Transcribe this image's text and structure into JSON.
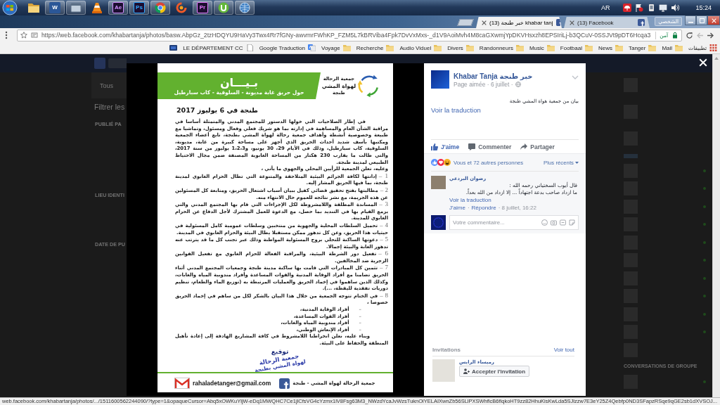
{
  "taskbar": {
    "items": [
      {
        "kind": "globe",
        "open": true
      },
      {
        "kind": "disc",
        "open": true
      },
      {
        "kind": "app-tile",
        "label": "Pr",
        "color": "#e77cff",
        "open": true
      },
      {
        "kind": "swirl",
        "open": false
      },
      {
        "kind": "ring",
        "open": true
      },
      {
        "kind": "app-tile",
        "label": "Ps",
        "color": "#31a8ff",
        "open": true
      },
      {
        "kind": "app-tile",
        "label": "Ae",
        "color": "#d291ff",
        "open": true
      },
      {
        "kind": "cone",
        "open": false
      },
      {
        "kind": "window",
        "open": true
      },
      {
        "kind": "doc-tile",
        "label": "W",
        "color": "#2b5797",
        "open": true
      },
      {
        "kind": "folder",
        "open": false
      }
    ],
    "language": "AR",
    "clock": "15:24"
  },
  "browser": {
    "tabs": [
      {
        "title": "(13) Facebook",
        "selected": false
      },
      {
        "title": "(13) خبر طنجة khabar tanj",
        "selected": true
      }
    ],
    "profile": "الشخصي",
    "navigation": {
      "back_disabled": false,
      "forward_disabled": true
    },
    "url": "https://web.facebook.com/khabartanja/photos/basw.AbpGz_2tzHDQYU9HaVy3Twx4Rr7fGNy-awvmrFWhKP_FZM5L7kBRViba4Fpk7DvVxMxs-_d1V9AoiMvh4M8caGXwmjYpDKVHsxzh8EPSIriLj-b3QCuV-0SSJVt9pDT6Hcqa3",
    "security": "آمن",
    "bookmarks": [
      {
        "kind": "apps",
        "label": "تطبيقات"
      },
      {
        "kind": "folder",
        "label": "Mail"
      },
      {
        "kind": "folder",
        "label": "Tanger"
      },
      {
        "kind": "folder",
        "label": "News"
      },
      {
        "kind": "folder",
        "label": "Footbaal"
      },
      {
        "kind": "folder",
        "label": "Music"
      },
      {
        "kind": "folder",
        "label": "Randonneurs"
      },
      {
        "kind": "folder",
        "label": "Divers"
      },
      {
        "kind": "folder",
        "label": "Audio Viduel"
      },
      {
        "kind": "folder",
        "label": "Recherche"
      },
      {
        "kind": "folder",
        "label": "Voyage"
      },
      {
        "kind": "translate",
        "label": "Google Traduction"
      },
      {
        "kind": "page",
        "label": "LE DÉPARTEMENT CC"
      },
      {
        "kind": "site"
      }
    ]
  },
  "facebook_page": {
    "tab": "Tous",
    "filters": {
      "title": "Filtrer les",
      "sections": [
        "PUBLIÉ PA",
        "LIEU IDENTI",
        "DATE DE PU"
      ]
    },
    "sidebar": [
      {
        "kind": "notice"
      },
      {
        "kind": "notice"
      },
      {
        "kind": "notice"
      },
      {
        "kind": "banner"
      },
      {
        "kind": "contact",
        "online": true
      },
      {
        "kind": "contact",
        "online": true
      },
      {
        "kind": "contact",
        "online": true
      },
      {
        "kind": "contact",
        "online": true
      },
      {
        "kind": "contact",
        "online": true
      },
      {
        "kind": "contact",
        "online": true
      },
      {
        "kind": "contact",
        "online": true
      },
      {
        "kind": "contact",
        "online": true
      },
      {
        "kind": "contact",
        "online": true
      },
      {
        "kind": "contact",
        "online": true
      },
      {
        "kind": "contact",
        "online": false
      },
      {
        "kind": "heading",
        "text": "CONVERSATIONS DE GROUPE"
      },
      {
        "kind": "contact",
        "online": true
      }
    ]
  },
  "photo_viewer": {
    "document": {
      "title": "بـيـــان",
      "subtitle": "حول حريق غابة مديونة - السلوقية - كاب سبارطيل",
      "logo_lines": [
        "جمعية الرحالة",
        "لهواة المشي",
        "طنجة"
      ],
      "date": "طنجة في 6 يوليوز 2017",
      "intro": "في إطار الصلاحيات التي خولها الدستور للمجتمع المدني والمتمثلة أساسا في مراقبة الشأن العام والمساهمة في إدارته بما هو شريك فعلي وفعال ومسئول، وتماشيا مع طبيعة وخصوصية أنشطة وأهداف جمعية رحالة لهواة المشي بطنجة، تابع أعضاء الجمعية ومكتبها بأسف شديد أحداث الحريق الذي أجهز على مساحة كبيرة من غابة، مديونة، السلوقية، كاب سبارطيل، وذلك في الأيام 29، 30 يونيو، و1،2،3 يوليوز من سنة 2017، والتي طالت ما يقارب 230 هكتار من المساحة الغابوية المصنفة ضمن مجال الاحتياط الطبيعي لمدينة طنجة.",
      "lead": "وعليه، تعلن الجمعية للرأيين المحلي والجهوي ما يأتي ،",
      "points": [
        {
          "marker": "1 –",
          "text": "إدانتها لكافة الجرائم البيئية المتلاحقة والمتنوعة التي تطال الحزام الغابوي لمدينة طنجة، بما فيها الحريق المشار إليه."
        },
        {
          "marker": "2 –",
          "text": "مطالبتها بفتح تحقيق قضائي كفيل ببيان أسباب اشتعال الحريق، ومتابعة كل المسئولين عن هذه الجريمة، مع نشر نتائجه للعموم حال الانتهاء منه."
        },
        {
          "marker": "3 –",
          "text": "المساندة المطلقة واللامشروطة لكل الإجراءات التي قام بها المجتمع المدني والتي يزمع القيام بها في التنديد بما حصل، مع الدعوة للعمل المشترك لأجل الدفاع عن الحزام الغابوي للمدينة."
        },
        {
          "marker": "4 –",
          "text": "تحميل السلطات المحلية والجهوية من منتخبين وسلطات عمومية كامل المسئولية في حيثيات هذا الحريق، وعن كل تدهور ممكن مستقبلا يطال البيئة والحزام الغابوي في المدينة."
        },
        {
          "marker": "5 –",
          "text": "دعوتها الساكنة للتحلي بروح المسئولية المواطنة وذلك عبر تجنب كل ما قد يترتب عنه تدهور الغابة والبيئة إجمالا."
        },
        {
          "marker": "6 –",
          "text": "تفعيل دور الشرطة البيئية، والمراقبة الفعالة للحزام الغابوي مع تفعيل القوانين الزجرية ضد المخالفين."
        },
        {
          "marker": "7 –",
          "text": "تثمين كل المبادرات التي قامت بها ساكنة مدينة طنجة وجمعيات المجتمع المدني أثناء الحريق تضامنا مع أفراد الوقاية المدنية والقوات المساعدة وأفراد مندوبية المياه والغابات، وكذلك الذين ساهموا في إخماد الحريق والعمليات المرتبطة به (توزيع الماء والطعام، تنظيم دوريات تفقدية لليقظة، ...)."
        },
        {
          "marker": "8 –",
          "text": "في الختام تتوجه الجمعية من خلال هذا البيان بالشكر لكل من ساهم في إخماد الحريق خصوصا ،"
        }
      ],
      "thanks": [
        {
          "marker": "–",
          "text": "أفراد الوقاية المدنية،"
        },
        {
          "marker": "–",
          "text": "أفراد القوات المساعدة،"
        },
        {
          "marker": "–",
          "text": "أفراد مندوبية المياه والغابات،"
        },
        {
          "marker": "–",
          "text": "أفراد الإنعاش الوطني،"
        }
      ],
      "closing": "وبناء عليه، نعلن انخراطنا اللامشروط في كافة المشاريع الهادفة إلى إعادة تأهيل المنطقة والحفاظ على البيئة.",
      "signature": "توقيع",
      "stamp_lines": [
        "جمعية الرحالة",
        "لهواة المشي بطنجة"
      ],
      "email": "rahaladetanger@gmail.com",
      "facebook": "جمعية الرحالة لهواة المشي - طنجة"
    },
    "panel": {
      "page_name": "Khabar Tanja خبر طنجة",
      "meta": "Page aimée · 6 juillet ·",
      "post_text": "بيان من جمعية هواة المشي طنجة",
      "translate": "Voir la traduction",
      "actions": [
        {
          "kind": "share",
          "label": "Partager",
          "active": false
        },
        {
          "kind": "comment",
          "label": "Commenter",
          "active": false
        },
        {
          "kind": "like",
          "label": "J'aime",
          "active": true
        }
      ],
      "reactions": {
        "summary": "Vous et 72 autres personnes",
        "sort": "Plus récents"
      },
      "comments": [
        {
          "author": "رضوان البردعي",
          "lines": [
            "قال أيوب السختياني رحمه الله :",
            "ما ازداد صاحب بدعة اجتهاداً ... إلا ازداد من الله بعداً."
          ],
          "translate": "Voir la traduction",
          "footer": [
            {
              "kind": "text",
              "text": "· 8 juillet, 16:22"
            },
            {
              "kind": "link",
              "text": "Répondre"
            },
            {
              "kind": "text",
              "text": "·"
            },
            {
              "kind": "link",
              "text": "J'aime"
            }
          ]
        }
      ],
      "composer": {
        "placeholder": "Votre commentaire..."
      },
      "invitations": {
        "title": "Invitations",
        "see_all": "Voir tout",
        "items": [
          {
            "name": "رميساء الرايس",
            "button": "Accepter l'invitation"
          }
        ]
      }
    }
  },
  "status_bar": "web.facebook.com/khabartanja/photos/.../1511600562244090/?type=1&opaqueCursor=Abq5xOWKuYljW-eDq1MWQHC7Ce1jlCfsVG4cYzmx1lV8Fsg63M3_NWzdYcaJvWzsTuknOlYELAIXwnZb56SLlPXSWhflcB6fiqkoHT9zz82HhuKisKwLda5SJlzzw7E3eY25Z4Qebfp0ND3SFapzRSqe9qGE2sb1dXVSOJ..."
}
